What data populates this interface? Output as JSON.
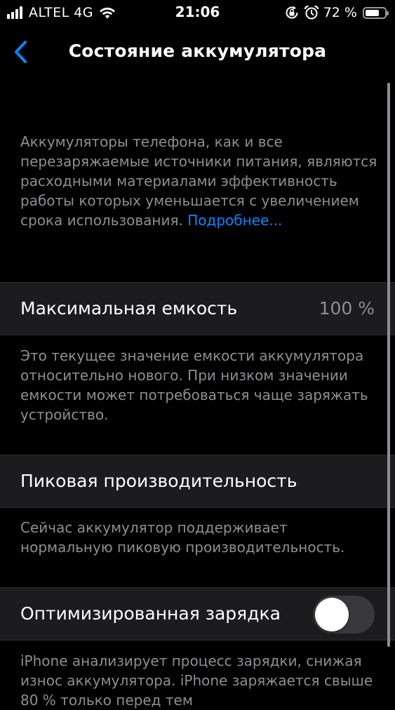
{
  "status_bar": {
    "carrier": "ALTEL 4G",
    "time": "21:06",
    "battery_percent": "72 %",
    "battery_level": 0.72,
    "icons": [
      "signal-icon",
      "wifi-icon",
      "orientation-lock-icon",
      "alarm-icon",
      "battery-icon"
    ]
  },
  "nav": {
    "title": "Состояние аккумулятора",
    "back_icon": "chevron-left-icon"
  },
  "intro": {
    "text": "Аккумуляторы телефона, как и все перезаряжаемые источники питания, являются расходными материалами эффективность работы которых уменьшается с увеличением срока использования.",
    "link": "Подробнее..."
  },
  "max_capacity": {
    "label": "Максимальная емкость",
    "value": "100 %",
    "footnote": "Это текущее значение емкости аккумулятора относительно нового. При низком значении емкости может потребоваться чаще заряжать устройство."
  },
  "peak_performance": {
    "label": "Пиковая производительность",
    "footnote": "Сейчас аккумулятор поддерживает нормальную пиковую производительность."
  },
  "optimized_charging": {
    "label": "Оптимизированная зарядка",
    "enabled": false,
    "footnote": "iPhone анализирует процесс зарядки, снижая износ аккумулятора. iPhone заряжается свыше 80 % только перед тем"
  },
  "colors": {
    "background": "#000000",
    "cell_background": "#1c1c1e",
    "secondary_text": "#8e8e93",
    "link": "#0a84ff",
    "toggle_off": "#39393d"
  }
}
